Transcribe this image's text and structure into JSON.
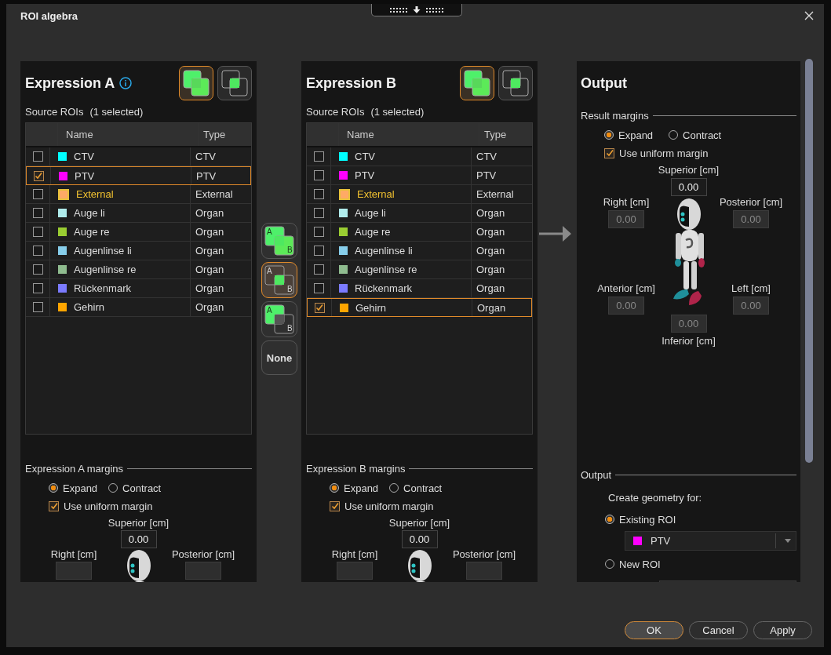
{
  "window": {
    "title": "ROI algebra"
  },
  "expressions": [
    {
      "title": "Expression A",
      "info": true,
      "modes": [
        {
          "kind": "union",
          "selected": true
        },
        {
          "kind": "intersection",
          "selected": false
        }
      ],
      "source_label": "Source ROIs",
      "count": "(1 selected)",
      "columns": [
        "Name",
        "Type"
      ],
      "rows": [
        {
          "kind": "roi",
          "checked": false,
          "name": "CTV",
          "type": "CTV",
          "color": "#00ffff"
        },
        {
          "kind": "roi",
          "checked": true,
          "name": "PTV",
          "type": "PTV",
          "color": "#ff00ff"
        },
        {
          "kind": "external",
          "checked": false,
          "name": "External",
          "type": "External",
          "color": "#ffaa66"
        },
        {
          "kind": "roi",
          "checked": false,
          "name": "Auge li",
          "type": "Organ",
          "color": "#b0ecec"
        },
        {
          "kind": "roi",
          "checked": false,
          "name": "Auge re",
          "type": "Organ",
          "color": "#9acd32"
        },
        {
          "kind": "roi",
          "checked": false,
          "name": "Augenlinse li",
          "type": "Organ",
          "color": "#87ceeb"
        },
        {
          "kind": "roi",
          "checked": false,
          "name": "Augenlinse re",
          "type": "Organ",
          "color": "#8fbc8f"
        },
        {
          "kind": "roi",
          "checked": false,
          "name": "Rückenmark",
          "type": "Organ",
          "color": "#7b7bff"
        },
        {
          "kind": "roi",
          "checked": false,
          "name": "Gehirn",
          "type": "Organ",
          "color": "#ffa500"
        }
      ],
      "margins": {
        "title": "Expression A margins",
        "options": [
          {
            "label": "Expand",
            "selected": true
          },
          {
            "label": "Contract",
            "selected": false
          }
        ],
        "uniform": {
          "label": "Use uniform margin",
          "checked": true
        },
        "fields": [
          {
            "kind": "superior",
            "label": "Superior [cm]",
            "value": "0.00",
            "disabled": false
          },
          {
            "kind": "right",
            "label": "Right [cm]",
            "disabled": true
          },
          {
            "kind": "posterior",
            "label": "Posterior [cm]",
            "disabled": true
          }
        ]
      }
    },
    {
      "title": "Expression B",
      "info": false,
      "modes": [
        {
          "kind": "union",
          "selected": true
        },
        {
          "kind": "intersection",
          "selected": false
        }
      ],
      "source_label": "Source ROIs",
      "count": "(1 selected)",
      "columns": [
        "Name",
        "Type"
      ],
      "rows": [
        {
          "kind": "roi",
          "checked": false,
          "name": "CTV",
          "type": "CTV",
          "color": "#00ffff"
        },
        {
          "kind": "roi",
          "checked": false,
          "name": "PTV",
          "type": "PTV",
          "color": "#ff00ff"
        },
        {
          "kind": "external",
          "checked": false,
          "name": "External",
          "type": "External",
          "color": "#ffaa66"
        },
        {
          "kind": "roi",
          "checked": false,
          "name": "Auge li",
          "type": "Organ",
          "color": "#b0ecec"
        },
        {
          "kind": "roi",
          "checked": false,
          "name": "Auge re",
          "type": "Organ",
          "color": "#9acd32"
        },
        {
          "kind": "roi",
          "checked": false,
          "name": "Augenlinse li",
          "type": "Organ",
          "color": "#87ceeb"
        },
        {
          "kind": "roi",
          "checked": false,
          "name": "Augenlinse re",
          "type": "Organ",
          "color": "#8fbc8f"
        },
        {
          "kind": "roi",
          "checked": false,
          "name": "Rückenmark",
          "type": "Organ",
          "color": "#7b7bff"
        },
        {
          "kind": "roi",
          "checked": true,
          "name": "Gehirn",
          "type": "Organ",
          "color": "#ffa500"
        }
      ],
      "margins": {
        "title": "Expression B margins",
        "options": [
          {
            "label": "Expand",
            "selected": true
          },
          {
            "label": "Contract",
            "selected": false
          }
        ],
        "uniform": {
          "label": "Use uniform margin",
          "checked": true
        },
        "fields": [
          {
            "kind": "superior",
            "label": "Superior [cm]",
            "value": "0.00",
            "disabled": false
          },
          {
            "kind": "right",
            "label": "Right [cm]",
            "disabled": true
          },
          {
            "kind": "posterior",
            "label": "Posterior [cm]",
            "disabled": true
          }
        ]
      }
    }
  ],
  "operations": [
    {
      "kind": "union",
      "labels": [
        "A",
        "B"
      ],
      "selected": false
    },
    {
      "kind": "intersection",
      "labels": [
        "A",
        "B"
      ],
      "selected": true
    },
    {
      "kind": "subtract",
      "labels": [
        "A",
        "B"
      ],
      "selected": false
    },
    {
      "kind": "none",
      "label": "None",
      "selected": false
    }
  ],
  "output": {
    "title": "Output",
    "result_margins": {
      "title": "Result margins",
      "options": [
        {
          "label": "Expand",
          "selected": true
        },
        {
          "label": "Contract",
          "selected": false
        }
      ],
      "uniform": {
        "label": "Use uniform margin",
        "checked": true
      },
      "fields": [
        {
          "kind": "superior",
          "label": "Superior [cm]",
          "value": "0.00",
          "disabled": false
        },
        {
          "kind": "right",
          "label": "Right [cm]",
          "value": "0.00",
          "disabled": true
        },
        {
          "kind": "posterior",
          "label": "Posterior [cm]",
          "value": "0.00",
          "disabled": true
        },
        {
          "kind": "anterior",
          "label": "Anterior [cm]",
          "value": "0.00",
          "disabled": true
        },
        {
          "kind": "left",
          "label": "Left [cm]",
          "value": "0.00",
          "disabled": true
        },
        {
          "kind": "inferior",
          "label": "Inferior [cm]",
          "value": "0.00",
          "disabled": true
        }
      ]
    },
    "section": {
      "title": "Output",
      "prompt": "Create geometry for:",
      "options": [
        {
          "label": "Existing ROI",
          "selected": true
        },
        {
          "label": "New ROI",
          "selected": false
        }
      ],
      "existing": {
        "name": "PTV",
        "color": "#ff00ff"
      }
    }
  },
  "buttons": [
    {
      "label": "OK",
      "default": true
    },
    {
      "label": "Cancel",
      "default": false
    },
    {
      "label": "Apply",
      "default": false
    }
  ]
}
